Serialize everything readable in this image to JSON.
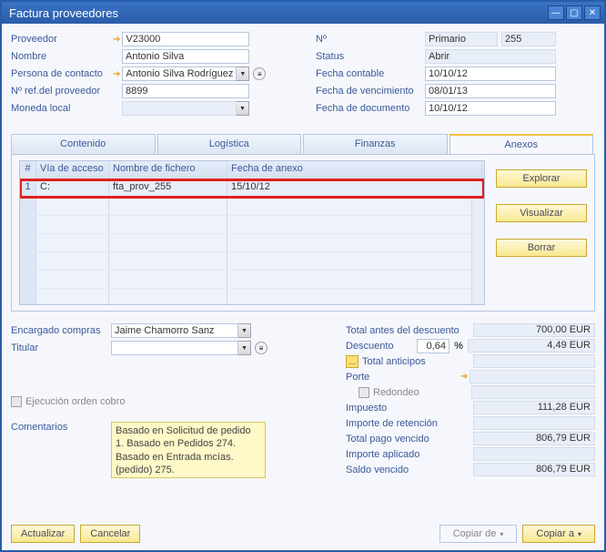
{
  "window": {
    "title": "Factura proveedores"
  },
  "form_left": {
    "proveedor_label": "Proveedor",
    "proveedor_value": "V23000",
    "nombre_label": "Nombre",
    "nombre_value": "Antonio Silva",
    "persona_label": "Persona de contacto",
    "persona_value": "Antonio Silva Rodríguez",
    "refprov_label": "Nº ref.del proveedor",
    "refprov_value": "8899",
    "moneda_label": "Moneda local"
  },
  "form_right": {
    "num_label": "Nº",
    "num_series": "Primario",
    "num_value": "255",
    "status_label": "Status",
    "status_value": "Abrir",
    "fcont_label": "Fecha contable",
    "fcont_value": "10/10/12",
    "fvenc_label": "Fecha de vencimiento",
    "fvenc_value": "08/01/13",
    "fdoc_label": "Fecha de documento",
    "fdoc_value": "10/10/12"
  },
  "tabs": {
    "t0": "Contenido",
    "t1": "Logística",
    "t2": "Finanzas",
    "t3": "Anexos"
  },
  "grid": {
    "h_num": "#",
    "h_path": "Vía de acceso",
    "h_file": "Nombre de fichero",
    "h_date": "Fecha de anexo",
    "rows": [
      {
        "n": "1",
        "path": "C:",
        "file": "fta_prov_255",
        "date": "15/10/12"
      }
    ]
  },
  "grid_buttons": {
    "explore": "Explorar",
    "view": "Visualizar",
    "delete": "Borrar"
  },
  "lower_left": {
    "encargado_label": "Encargado compras",
    "encargado_value": "Jaime Chamorro Sanz",
    "titular_label": "Titular",
    "titular_value": "",
    "ejecucion_label": "Ejecución orden cobro",
    "comentarios_label": "Comentarios",
    "comentarios_value": "Basado en Solicitud de pedido 1. Basado en Pedidos 274. Basado en Entrada mcías. (pedido) 275."
  },
  "totals": {
    "antes_label": "Total antes del descuento",
    "antes_value": "700,00 EUR",
    "desc_label": "Descuento",
    "desc_pct": "0,64",
    "pct_sign": "%",
    "desc_value": "4,49 EUR",
    "antic_label": "Total anticipos",
    "porte_label": "Porte",
    "redondeo_label": "Redondeo",
    "impuesto_label": "Impuesto",
    "impuesto_value": "111,28 EUR",
    "retencion_label": "Importe de retención",
    "pago_vencido_label": "Total pago vencido",
    "pago_vencido_value": "806,79 EUR",
    "aplicado_label": "Importe aplicado",
    "saldo_label": "Saldo vencido",
    "saldo_value": "806,79 EUR"
  },
  "footer": {
    "actualizar": "Actualizar",
    "cancelar": "Cancelar",
    "copiar_de": "Copiar de",
    "copiar_a": "Copiar a"
  }
}
